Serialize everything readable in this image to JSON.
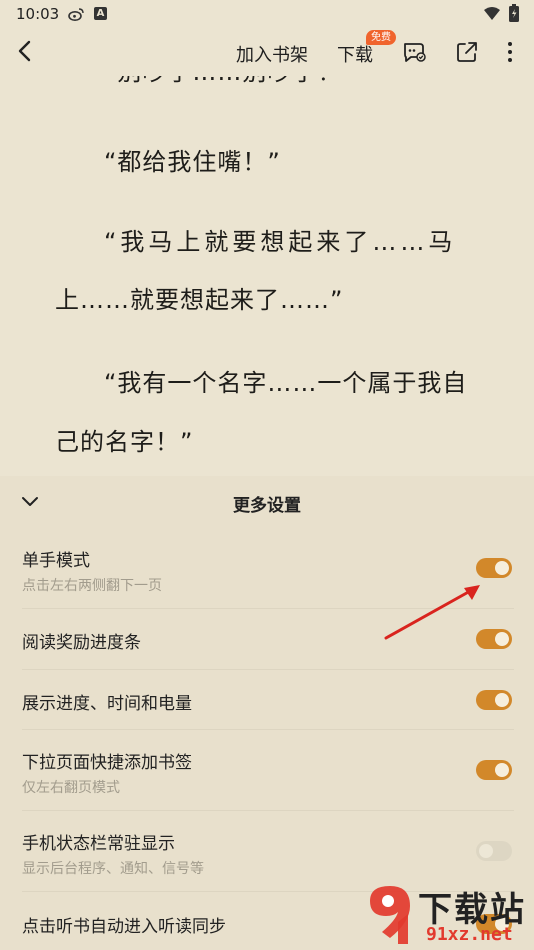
{
  "status_bar": {
    "time": "10:03",
    "a_badge": "A"
  },
  "topbar": {
    "add_to_shelf": "加入书架",
    "download": "下载",
    "free_badge": "免费"
  },
  "reading": {
    "cut_line": "“别吵了……别吵了！”",
    "p1": "“都给我住嘴！”",
    "p2_line1": "“我马上就要想起来了……马",
    "p2_line2": "上……就要想起来了……”",
    "p3_line1": "“我有一个名字……一个属于我自",
    "p3_line2": "己的名字！”"
  },
  "settings": {
    "title": "更多设置",
    "items": [
      {
        "label": "单手模式",
        "sub": "点击左右两侧翻下一页",
        "on": true
      },
      {
        "label": "阅读奖励进度条",
        "sub": "",
        "on": true
      },
      {
        "label": "展示进度、时间和电量",
        "sub": "",
        "on": true
      },
      {
        "label": "下拉页面快捷添加书签",
        "sub": "仅左右翻页模式",
        "on": true
      },
      {
        "label": "手机状态栏常驻显示",
        "sub": "显示后台程序、通知、信号等",
        "on": false
      },
      {
        "label": "点击听书自动进入听读同步",
        "sub": "",
        "on": true
      }
    ]
  },
  "watermark": {
    "brand": "下载站",
    "domain": "91xz.net"
  },
  "colors": {
    "accent": "#d2882a",
    "badge": "#f0642d",
    "annotation_arrow": "#d9241e"
  }
}
